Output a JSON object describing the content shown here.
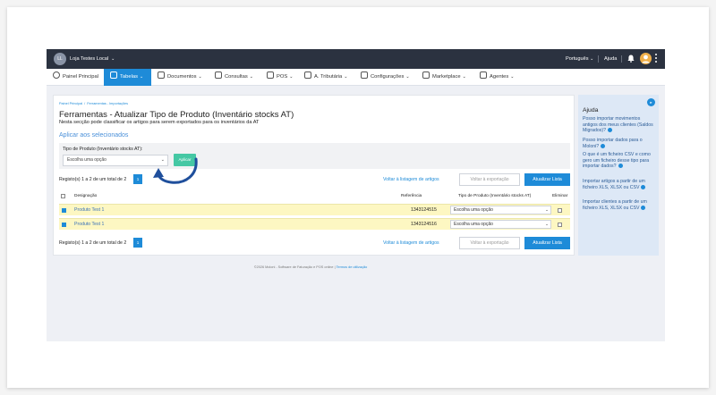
{
  "topbar": {
    "initials": "LL",
    "store_name": "Loja Testes Local",
    "language": "Português",
    "help": "Ajuda"
  },
  "nav": {
    "items": [
      {
        "label": "Painel Principal",
        "icon": "clock-icon",
        "dropdown": false
      },
      {
        "label": "Tabelas",
        "icon": "people-icon",
        "dropdown": true,
        "active": true
      },
      {
        "label": "Documentos",
        "icon": "document-icon",
        "dropdown": true
      },
      {
        "label": "Consultas",
        "icon": "list-icon",
        "dropdown": true
      },
      {
        "label": "POS",
        "icon": "monitor-icon",
        "dropdown": true
      },
      {
        "label": "A. Tributária",
        "icon": "scale-icon",
        "dropdown": true
      },
      {
        "label": "Configurações",
        "icon": "sliders-icon",
        "dropdown": true
      },
      {
        "label": "Marketplace",
        "icon": "store-icon",
        "dropdown": true
      },
      {
        "label": "Agentes",
        "icon": "handshake-icon",
        "dropdown": true
      }
    ]
  },
  "breadcrumb": [
    "Painel Principal",
    "/",
    "Ferramentas - Importações"
  ],
  "page": {
    "title": "Ferramentas - Atualizar Tipo de Produto (Inventário stocks AT)",
    "subtitle": "Nesta secção pode classificar os artigos para serem exportados para os inventários da AT",
    "apply_selected": "Aplicar aos selecionados",
    "field_label": "Tipo de Produto (Inventário stocks AT):",
    "select_placeholder": "Escolha uma opção",
    "apply_button": "Aplicar"
  },
  "pagination": {
    "summary": "Registo(s) 1 a 2 de um total de 2",
    "page": "1",
    "back_link": "Voltar à listagem de artigos",
    "back_export": "Voltar à exportação",
    "update": "Atualizar Lista"
  },
  "table": {
    "headers": [
      "Designação",
      "Referência",
      "Tipo de Produto (Inventário stocks AT)",
      "Eliminar"
    ],
    "rows": [
      {
        "name": "Produto Test 1",
        "ref": "1343124515",
        "type": "Escolha uma opção",
        "checked": true
      },
      {
        "name": "Produto Test 1",
        "ref": "1343124516",
        "type": "Escolha uma opção",
        "checked": true
      }
    ]
  },
  "footer": {
    "text": "©2026 Moloni - Software de Faturação e POS online",
    "sep": "|",
    "link": "Termos de utilização"
  },
  "help_panel": {
    "title": "Ajuda",
    "questions": [
      "Posso importar movimentos antigos dos meus clientes (Saldos Migrados)?",
      "Posso importar dados para o Moloni?",
      "O que é um ficheiro CSV e como gero um ficheiro desse tipo para importar dados?",
      "Importar artigos a partir de um ficheiro XLS, XLSX ou CSV",
      "Importar clientes a partir de um ficheiro XLS, XLSX ou CSV"
    ]
  },
  "colors": {
    "topbar": "#2b3240",
    "primary": "#1e8bd8",
    "apply": "#45c8a4",
    "row_highlight": "#fdf7c2",
    "help_panel": "#dde8f6"
  }
}
